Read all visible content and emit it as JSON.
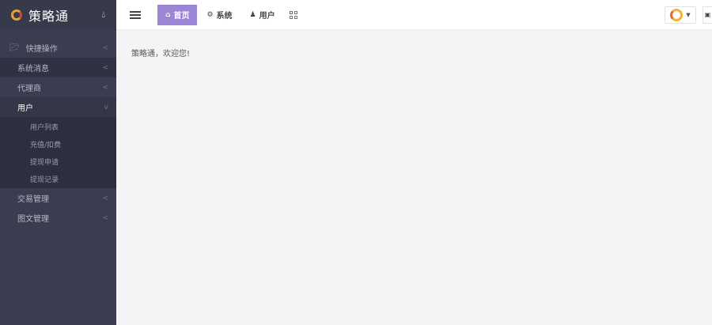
{
  "sidebar": {
    "brand_title": "策略通",
    "brand_drop_icon": "droplet-icon",
    "items": [
      {
        "label": "快捷操作",
        "icon": "folder-open-icon",
        "chevron": "<"
      },
      {
        "label": "系统消息",
        "chevron": "<"
      },
      {
        "label": "代理商",
        "chevron": "<"
      },
      {
        "label": "用户",
        "chevron": "v",
        "expanded": true,
        "children": [
          "用户列表",
          "充值/扣费",
          "提现申请",
          "提现记录"
        ]
      },
      {
        "label": "交易管理",
        "chevron": "<"
      },
      {
        "label": "图文管理",
        "chevron": "<"
      }
    ]
  },
  "topbar": {
    "tabs": [
      {
        "label": "首页",
        "icon": "home-icon",
        "active": true
      },
      {
        "label": "系统",
        "icon": "gear-icon"
      },
      {
        "label": "用户",
        "icon": "user-icon"
      }
    ]
  },
  "main": {
    "welcome": "策略通，欢迎您!"
  },
  "colors": {
    "sidebar_bg": "#3a3d4f",
    "active_tab": "#9b86d6",
    "content_bg": "#f4f4f7"
  }
}
